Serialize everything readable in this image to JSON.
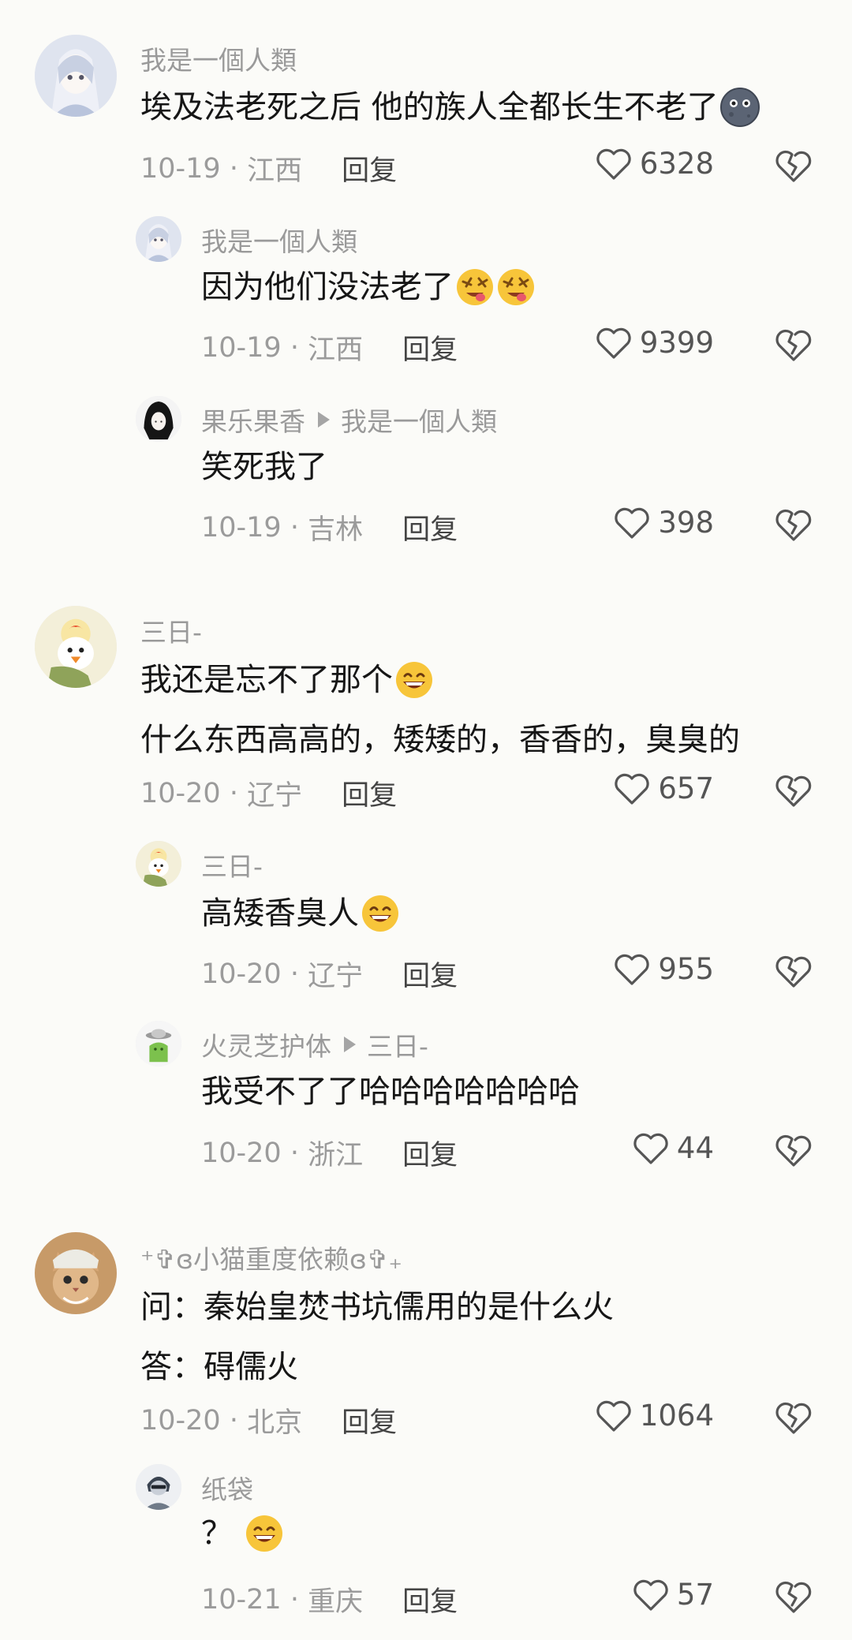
{
  "comments": [
    {
      "author": "我是一個人類",
      "lines": [
        "埃及法老死之后 他的族人全都长生不老了"
      ],
      "date": "10-19",
      "location": "江西",
      "reply_label": "回复",
      "likes": "6328",
      "replies": [
        {
          "author": "我是一個人類",
          "lines": [
            "因为他们没法老了"
          ],
          "date": "10-19",
          "location": "江西",
          "reply_label": "回复",
          "likes": "9399"
        },
        {
          "author": "果乐果香",
          "reply_to": "我是一個人類",
          "lines": [
            "笑死我了"
          ],
          "date": "10-19",
          "location": "吉林",
          "reply_label": "回复",
          "likes": "398"
        }
      ]
    },
    {
      "author": "三日-",
      "lines": [
        "我还是忘不了那个",
        "什么东西高高的，矮矮的，香香的，臭臭的"
      ],
      "date": "10-20",
      "location": "辽宁",
      "reply_label": "回复",
      "likes": "657",
      "replies": [
        {
          "author": "三日-",
          "lines": [
            "高矮香臭人"
          ],
          "date": "10-20",
          "location": "辽宁",
          "reply_label": "回复",
          "likes": "955"
        },
        {
          "author": "火灵芝护体",
          "reply_to": "三日-",
          "lines": [
            "我受不了了哈哈哈哈哈哈哈"
          ],
          "date": "10-20",
          "location": "浙江",
          "reply_label": "回复",
          "likes": "44"
        }
      ]
    },
    {
      "author": "⁺✞ɞ小猫重度依赖ɞ✞₊",
      "lines": [
        "问：秦始皇焚书坑儒用的是什么火",
        "答：碍儒火"
      ],
      "date": "10-20",
      "location": "北京",
      "reply_label": "回复",
      "likes": "1064",
      "replies": [
        {
          "author": "纸袋",
          "lines": [
            "？"
          ],
          "date": "10-21",
          "location": "重庆",
          "reply_label": "回复",
          "likes": "57"
        }
      ]
    }
  ],
  "meta_separator": "·",
  "colors": {
    "background": "#fbfbf8",
    "text": "#161616",
    "muted": "#9b9b9b"
  },
  "icons": [
    "heart-outline-icon",
    "broken-heart-icon",
    "moon-face-emoji",
    "drooling-face-emoji",
    "grinning-face-emoji",
    "reply-arrow-icon"
  ]
}
